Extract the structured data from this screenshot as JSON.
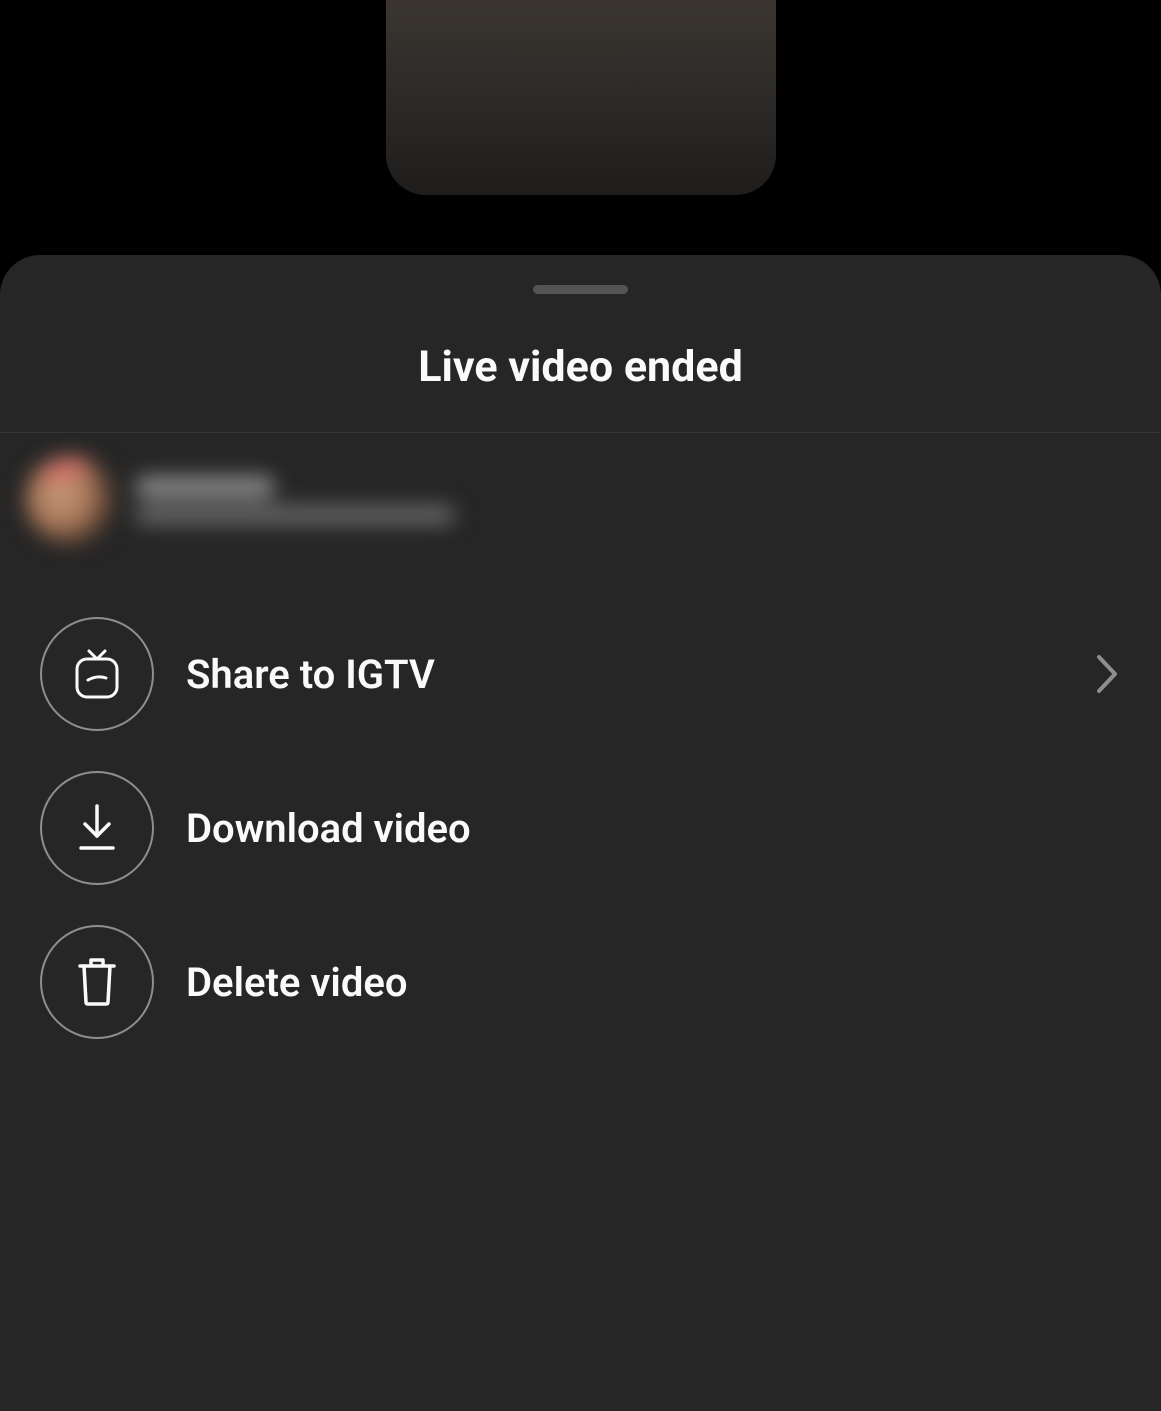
{
  "sheet": {
    "title": "Live video ended",
    "options": [
      {
        "label": "Share to IGTV",
        "icon": "igtv",
        "hasChevron": true
      },
      {
        "label": "Download video",
        "icon": "download",
        "hasChevron": false
      },
      {
        "label": "Delete video",
        "icon": "trash",
        "hasChevron": false
      }
    ]
  }
}
